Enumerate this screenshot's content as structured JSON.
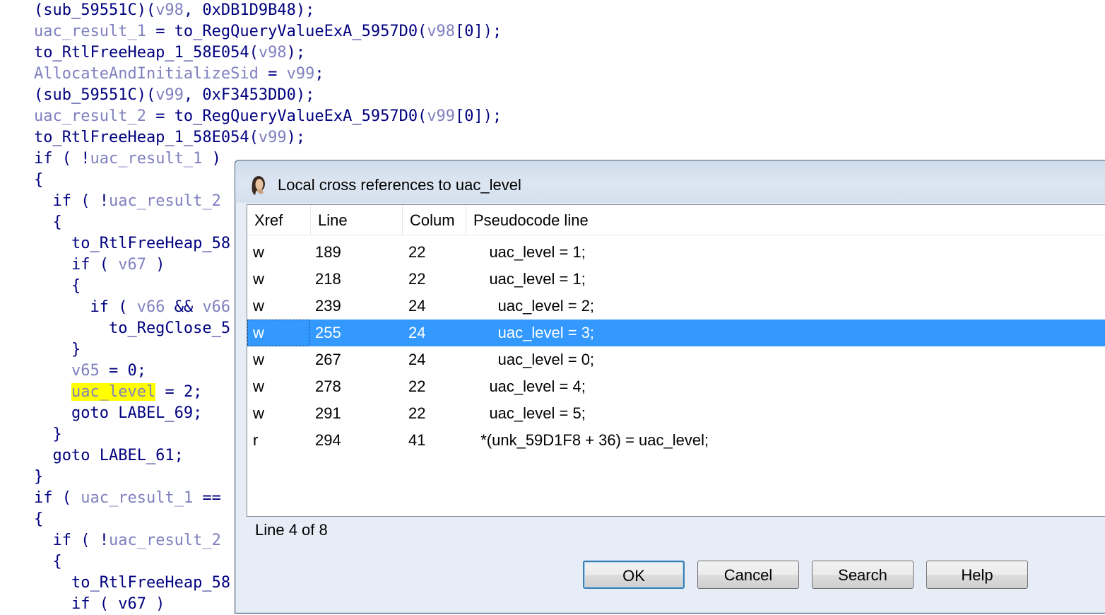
{
  "code": [
    [
      {
        "t": "(sub_59551C)(",
        "c": "id"
      },
      {
        "t": "v98",
        "c": "var"
      },
      {
        "t": ", 0xDB1D9B48);",
        "c": "id"
      }
    ],
    [
      {
        "t": "uac_result_1",
        "c": "var"
      },
      {
        "t": " = to_RegQueryValueExA_5957D0(",
        "c": "id"
      },
      {
        "t": "v98",
        "c": "var"
      },
      {
        "t": "[0]);",
        "c": "id"
      }
    ],
    [
      {
        "t": "to_RtlFreeHeap_1_58E054(",
        "c": "id"
      },
      {
        "t": "v98",
        "c": "var"
      },
      {
        "t": ");",
        "c": "id"
      }
    ],
    [
      {
        "t": "AllocateAndInitializeSid",
        "c": "var"
      },
      {
        "t": " = ",
        "c": "id"
      },
      {
        "t": "v99",
        "c": "var"
      },
      {
        "t": ";",
        "c": "id"
      }
    ],
    [
      {
        "t": "(sub_59551C)(",
        "c": "id"
      },
      {
        "t": "v99",
        "c": "var"
      },
      {
        "t": ", 0xF3453DD0);",
        "c": "id"
      }
    ],
    [
      {
        "t": "uac_result_2",
        "c": "var"
      },
      {
        "t": " = to_RegQueryValueExA_5957D0(",
        "c": "id"
      },
      {
        "t": "v99",
        "c": "var"
      },
      {
        "t": "[0]);",
        "c": "id"
      }
    ],
    [
      {
        "t": "to_RtlFreeHeap_1_58E054(",
        "c": "id"
      },
      {
        "t": "v99",
        "c": "var"
      },
      {
        "t": ");",
        "c": "id"
      }
    ],
    [
      {
        "t": "if ( !",
        "c": "id"
      },
      {
        "t": "uac_result_1",
        "c": "var"
      },
      {
        "t": " )",
        "c": "id"
      }
    ],
    [
      {
        "t": "{",
        "c": "id"
      }
    ],
    [
      {
        "t": "  if ( !",
        "c": "id"
      },
      {
        "t": "uac_result_2",
        "c": "var"
      }
    ],
    [
      {
        "t": "  {",
        "c": "id"
      }
    ],
    [
      {
        "t": "    to_RtlFreeHeap_58",
        "c": "id"
      }
    ],
    [
      {
        "t": "    if ( ",
        "c": "id"
      },
      {
        "t": "v67",
        "c": "var"
      },
      {
        "t": " )",
        "c": "id"
      }
    ],
    [
      {
        "t": "    {",
        "c": "id"
      }
    ],
    [
      {
        "t": "      if ( ",
        "c": "id"
      },
      {
        "t": "v66",
        "c": "var"
      },
      {
        "t": " && ",
        "c": "id"
      },
      {
        "t": "v66",
        "c": "var"
      }
    ],
    [
      {
        "t": "        to_RegClose_5",
        "c": "id"
      }
    ],
    [
      {
        "t": "    }",
        "c": "id"
      }
    ],
    [
      {
        "t": "    ",
        "c": "id"
      },
      {
        "t": "v65",
        "c": "var"
      },
      {
        "t": " = 0;",
        "c": "id"
      }
    ],
    [
      {
        "t": "    ",
        "c": "id"
      },
      {
        "t": "uac_level",
        "c": "hl"
      },
      {
        "t": " = 2;",
        "c": "id"
      }
    ],
    [
      {
        "t": "    goto LABEL_69;",
        "c": "id"
      }
    ],
    [
      {
        "t": "  }",
        "c": "id"
      }
    ],
    [
      {
        "t": "  goto LABEL_61;",
        "c": "id"
      }
    ],
    [
      {
        "t": "}",
        "c": "id"
      }
    ],
    [
      {
        "t": "if ( ",
        "c": "id"
      },
      {
        "t": "uac_result_1",
        "c": "var"
      },
      {
        "t": " ==",
        "c": "id"
      }
    ],
    [
      {
        "t": "{",
        "c": "id"
      }
    ],
    [
      {
        "t": "  if ( !",
        "c": "id"
      },
      {
        "t": "uac_result_2",
        "c": "var"
      }
    ],
    [
      {
        "t": "  {",
        "c": "id"
      }
    ],
    [
      {
        "t": "    to_RtlFreeHeap_58",
        "c": "id"
      }
    ],
    [
      {
        "t": "    if ( v67 )",
        "c": "id"
      }
    ]
  ],
  "dialog": {
    "title": "Local cross references to uac_level",
    "columns": [
      "Xref",
      "Line",
      "Colum",
      "Pseudocode line"
    ],
    "rows": [
      {
        "xref": "w",
        "line": "189",
        "col": "22",
        "code": "    uac_level = 1;"
      },
      {
        "xref": "w",
        "line": "218",
        "col": "22",
        "code": "    uac_level = 1;"
      },
      {
        "xref": "w",
        "line": "239",
        "col": "24",
        "code": "      uac_level = 2;"
      },
      {
        "xref": "w",
        "line": "255",
        "col": "24",
        "code": "      uac_level = 3;"
      },
      {
        "xref": "w",
        "line": "267",
        "col": "24",
        "code": "      uac_level = 0;"
      },
      {
        "xref": "w",
        "line": "278",
        "col": "22",
        "code": "    uac_level = 4;"
      },
      {
        "xref": "w",
        "line": "291",
        "col": "22",
        "code": "    uac_level = 5;"
      },
      {
        "xref": "r",
        "line": "294",
        "col": "41",
        "code": "  *(unk_59D1F8 + 36) = uac_level;"
      }
    ],
    "selected_row": 3,
    "status": "Line 4 of 8",
    "buttons": {
      "ok": "OK",
      "cancel": "Cancel",
      "search": "Search",
      "help": "Help"
    }
  }
}
